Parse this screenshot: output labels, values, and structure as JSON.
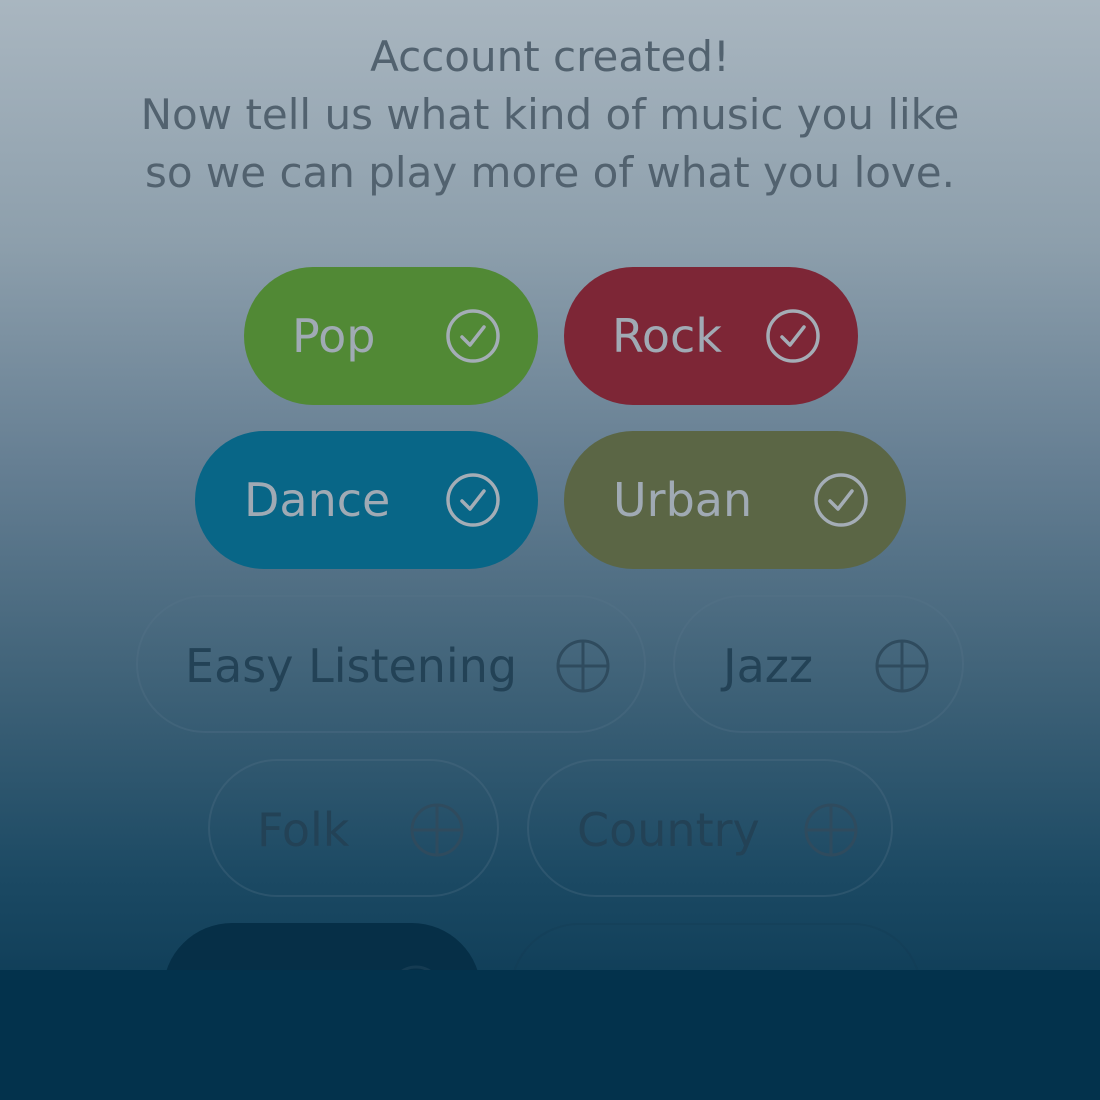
{
  "header": {
    "line1": "Account created!",
    "line2": "Now tell us what kind of music you like",
    "line3": "so we can play more of what you love."
  },
  "genres": {
    "pop": {
      "label": "Pop",
      "selected": true,
      "color": "#518935"
    },
    "rock": {
      "label": "Rock",
      "selected": true,
      "color": "#7d2636"
    },
    "dance": {
      "label": "Dance",
      "selected": true,
      "color": "#086687"
    },
    "urban": {
      "label": "Urban",
      "selected": true,
      "color": "#5b6645"
    },
    "easy_listening": {
      "label": "Easy Listening",
      "selected": false
    },
    "jazz": {
      "label": "Jazz",
      "selected": false
    },
    "folk": {
      "label": "Folk",
      "selected": false
    },
    "country": {
      "label": "Country",
      "selected": false
    }
  },
  "icons": {
    "selected": "check-circle-icon",
    "unselected": "plus-circle-icon"
  },
  "colors": {
    "bottom_bar": "#03324c",
    "header_text": "#52626f"
  }
}
